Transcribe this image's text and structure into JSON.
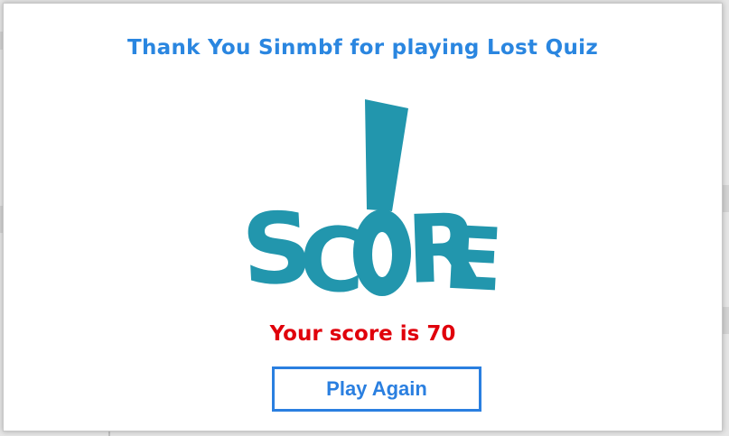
{
  "dialog": {
    "title": "Thank You Sinmbf for playing Lost Quiz",
    "score_graphic": {
      "icon": "exclamation-score-logo",
      "letters": [
        "S",
        "C",
        "R",
        "E"
      ],
      "color": "#2296ad"
    },
    "score_message": "Your score is 70",
    "play_again_label": "Play Again"
  },
  "colors": {
    "title": "#2a86e0",
    "score": "#e0000b",
    "button": "#2a7fe0"
  }
}
